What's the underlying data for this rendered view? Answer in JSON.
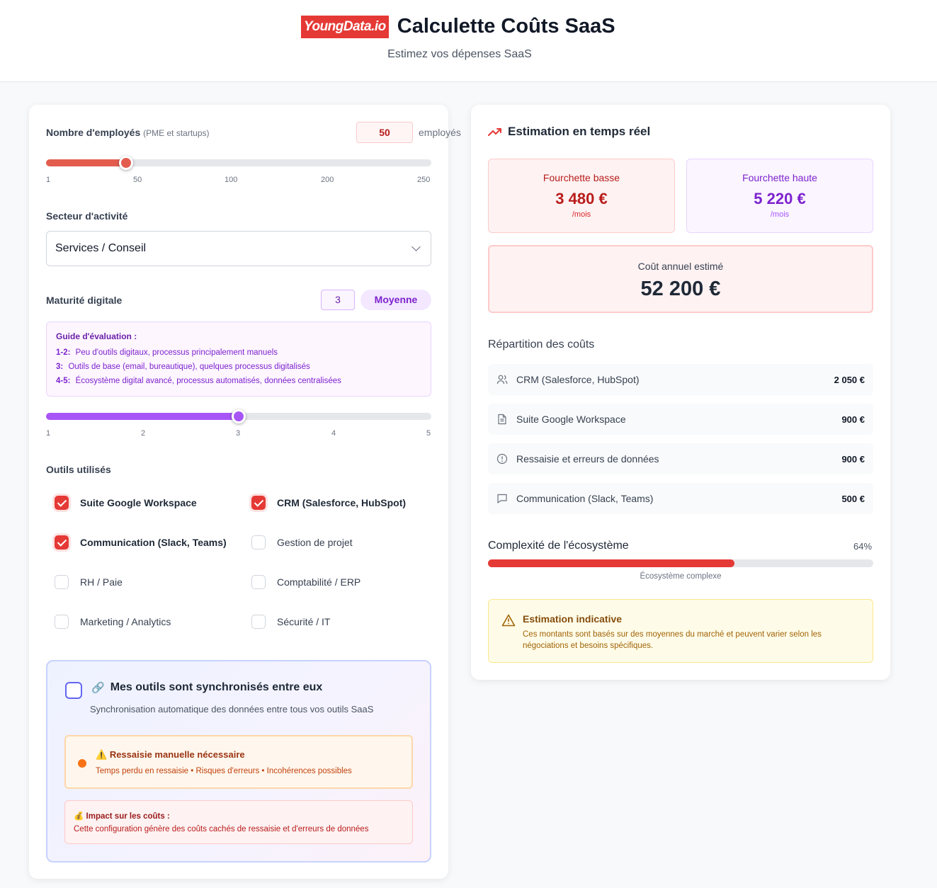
{
  "header": {
    "logo_text": "YoungData.io",
    "title": "Calculette Coûts SaaS",
    "subtitle": "Estimez vos dépenses SaaS"
  },
  "employees": {
    "label": "Nombre d'employés",
    "hint": "(PME et startups)",
    "value": "50",
    "unit": "employés",
    "slider_fraction": 0.207,
    "ticks": [
      "1",
      "50",
      "100",
      "200",
      "250"
    ]
  },
  "sector": {
    "label": "Secteur d'activité",
    "selected": "Services / Conseil"
  },
  "maturity": {
    "label": "Maturité digitale",
    "value": "3",
    "level": "Moyenne",
    "guide_title": "Guide d'évaluation :",
    "guide": [
      {
        "range": "1-2:",
        "text": "Peu d'outils digitaux, processus principalement manuels"
      },
      {
        "range": "3:",
        "text": "Outils de base (email, bureautique), quelques processus digitalisés"
      },
      {
        "range": "4-5:",
        "text": "Écosystème digital avancé, processus automatisés, données centralisées"
      }
    ],
    "slider_fraction": 0.5,
    "ticks": [
      "1",
      "2",
      "3",
      "4",
      "5"
    ]
  },
  "tools": {
    "label": "Outils utilisés",
    "items": [
      {
        "label": "Suite Google Workspace",
        "checked": true
      },
      {
        "label": "CRM (Salesforce, HubSpot)",
        "checked": true
      },
      {
        "label": "Communication (Slack, Teams)",
        "checked": true
      },
      {
        "label": "Gestion de projet",
        "checked": false
      },
      {
        "label": "RH / Paie",
        "checked": false
      },
      {
        "label": "Comptabilité / ERP",
        "checked": false
      },
      {
        "label": "Marketing / Analytics",
        "checked": false
      },
      {
        "label": "Sécurité / IT",
        "checked": false
      }
    ]
  },
  "sync": {
    "checked": false,
    "title": "Mes outils sont synchronisés entre eux",
    "description": "Synchronisation automatique des données entre tous vos outils SaaS",
    "warning_title": "Ressaisie manuelle nécessaire",
    "warning_text": "Temps perdu en ressaisie • Risques d'erreurs • Incohérences possibles",
    "impact_title": "Impact sur les coûts :",
    "impact_text": "Cette configuration génère des coûts cachés de ressaisie et d'erreurs de données"
  },
  "estimate": {
    "title": "Estimation en temps réel",
    "low_label": "Fourchette basse",
    "low_value": "3 480 €",
    "high_label": "Fourchette haute",
    "high_value": "5 220 €",
    "per_month": "/mois",
    "annual_label": "Coût annuel estimé",
    "annual_value": "52 200 €"
  },
  "breakdown": {
    "title": "Répartition des coûts",
    "items": [
      {
        "icon": "users-icon",
        "name": "CRM (Salesforce, HubSpot)",
        "value": "2 050 €"
      },
      {
        "icon": "document-icon",
        "name": "Suite Google Workspace",
        "value": "900 €"
      },
      {
        "icon": "alert-circle-icon",
        "name": "Ressaisie et erreurs de données",
        "value": "900 €"
      },
      {
        "icon": "message-icon",
        "name": "Communication (Slack, Teams)",
        "value": "500 €"
      }
    ]
  },
  "complexity": {
    "title": "Complexité de l'écosystème",
    "percent_label": "64%",
    "percent": 64,
    "caption": "Écosystème complexe"
  },
  "note": {
    "title": "Estimation indicative",
    "text": "Ces montants sont basés sur des moyennes du marché et peuvent varier selon les négociations et besoins spécifiques."
  },
  "colors": {
    "accent_red": "#e53935",
    "accent_purple": "#a855f7",
    "warning_orange": "#f97316"
  }
}
